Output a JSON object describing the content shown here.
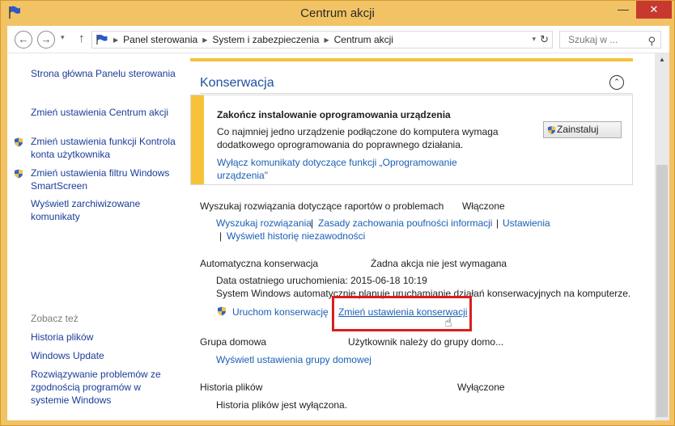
{
  "window": {
    "title": "Centrum akcji",
    "minimize_glyph": "—",
    "close_glyph": "✕"
  },
  "address": {
    "back_glyph": "←",
    "forward_glyph": "→",
    "up_glyph": "↑",
    "dropdown_glyph": "▾",
    "crumbs": [
      "Panel sterowania",
      "System i zabezpieczenia",
      "Centrum akcji"
    ],
    "refresh_glyph": "↻",
    "search_placeholder": "Szukaj w ...",
    "search_glyph": "⚲"
  },
  "sidebar": {
    "links": [
      "Strona główna Panelu sterowania",
      "Zmień ustawienia Centrum akcji",
      "Zmień ustawienia funkcji Kontrola konta użytkownika",
      "Zmień ustawienia filtru Windows SmartScreen",
      "Wyświetl zarchiwizowane komunikaty"
    ],
    "see_also_heading": "Zobacz też",
    "see_also": [
      "Historia plików",
      "Windows Update",
      "Rozwiązywanie problemów ze zgodnością programów w systemie Windows"
    ]
  },
  "main": {
    "section_title": "Konserwacja",
    "collapse_glyph": "⌃",
    "alert": {
      "title": "Zakończ instalowanie oprogramowania urządzenia",
      "body": "Co najmniej jedno urządzenie podłączone do komputera wymaga dodatkowego oprogramowania do poprawnego działania.",
      "link": "Wyłącz komunikaty dotyczące funkcji „Oprogramowanie urządzenia\"",
      "button": "Zainstaluj"
    },
    "reports": {
      "label": "Wyszukaj rozwiązania dotyczące raportów o problemach",
      "status": "Włączone",
      "links": [
        "Wyszukaj rozwiązania",
        "Zasady zachowania poufności informacji",
        "Ustawienia",
        "Wyświetl historię niezawodności"
      ]
    },
    "auto_maintenance": {
      "label": "Automatyczna konserwacja",
      "status": "Żadna akcja nie jest wymagana",
      "last_run": "Data ostatniego uruchomienia: 2015-06-18 10:19",
      "description": "System Windows automatycznie planuje uruchamianie działań konserwacyjnych na komputerze.",
      "start_link": "Uruchom konserwację",
      "settings_link": "Zmień ustawienia konserwacji"
    },
    "homegroup": {
      "label": "Grupa domowa",
      "status": "Użytkownik należy do grupy domo...",
      "link": "Wyświetl ustawienia grupy domowej"
    },
    "file_history": {
      "label": "Historia plików",
      "status": "Wyłączone",
      "text": "Historia plików jest wyłączona."
    },
    "pipe": "|"
  },
  "colors": {
    "titlebar": "#f2c365",
    "link": "#1a5fb4",
    "section_title": "#1f4fa3",
    "alert_bar": "#f5c23a",
    "highlight": "#d91f1f",
    "close_button": "#c7382f"
  }
}
